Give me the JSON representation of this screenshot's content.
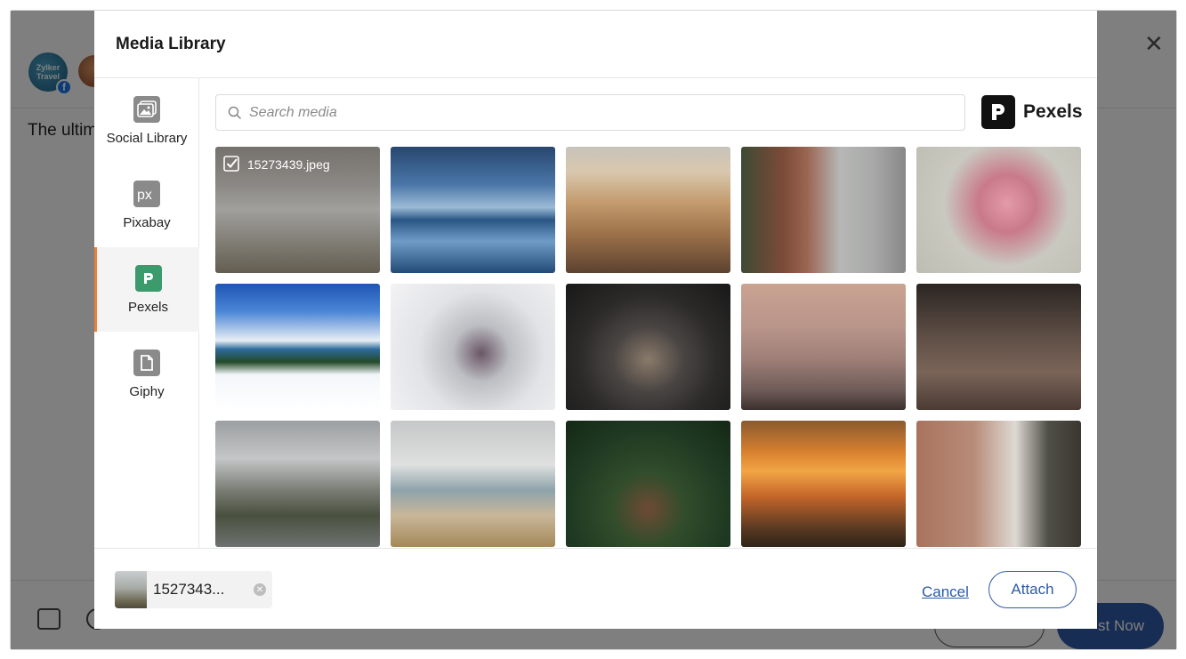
{
  "background": {
    "avatar_text": "Zylker Travel",
    "post_text": "The ultim",
    "post_now_label": "st Now",
    "social_network_badge": "f"
  },
  "modal": {
    "title": "Media Library",
    "sidebar": {
      "items": [
        {
          "label": "Social Library",
          "icon": "image-library-icon",
          "active": false
        },
        {
          "label": "Pixabay",
          "icon": "pixabay-icon",
          "active": false
        },
        {
          "label": "Pexels",
          "icon": "pexels-icon",
          "active": true
        },
        {
          "label": "Giphy",
          "icon": "giphy-icon",
          "active": false
        }
      ]
    },
    "search": {
      "placeholder": "Search media",
      "value": ""
    },
    "provider": {
      "name": "Pexels",
      "icon": "pexels-logo-icon"
    },
    "media": [
      {
        "name": "15273439.jpeg",
        "selected": true,
        "description": "foggy aerial landscape"
      },
      {
        "description": "blue coastal seascape with fort"
      },
      {
        "description": "desert butte mountain"
      },
      {
        "description": "gothic clock tower building"
      },
      {
        "description": "pink cherry blossom branches"
      },
      {
        "description": "skiers on snowy slope by lake"
      },
      {
        "description": "person with umbrella in snowy forest"
      },
      {
        "description": "gothic cathedral interior"
      },
      {
        "description": "two people sitting by sea at dusk"
      },
      {
        "description": "dark forest floor"
      },
      {
        "description": "misty coastal cliffs"
      },
      {
        "description": "beach and cliffs"
      },
      {
        "description": "palm jungle with hut"
      },
      {
        "description": "orange sunset over misty forest"
      },
      {
        "description": "vintage scooter by wall"
      }
    ],
    "footer": {
      "selected_chip_label": "1527343...",
      "cancel_label": "Cancel",
      "attach_label": "Attach"
    }
  }
}
